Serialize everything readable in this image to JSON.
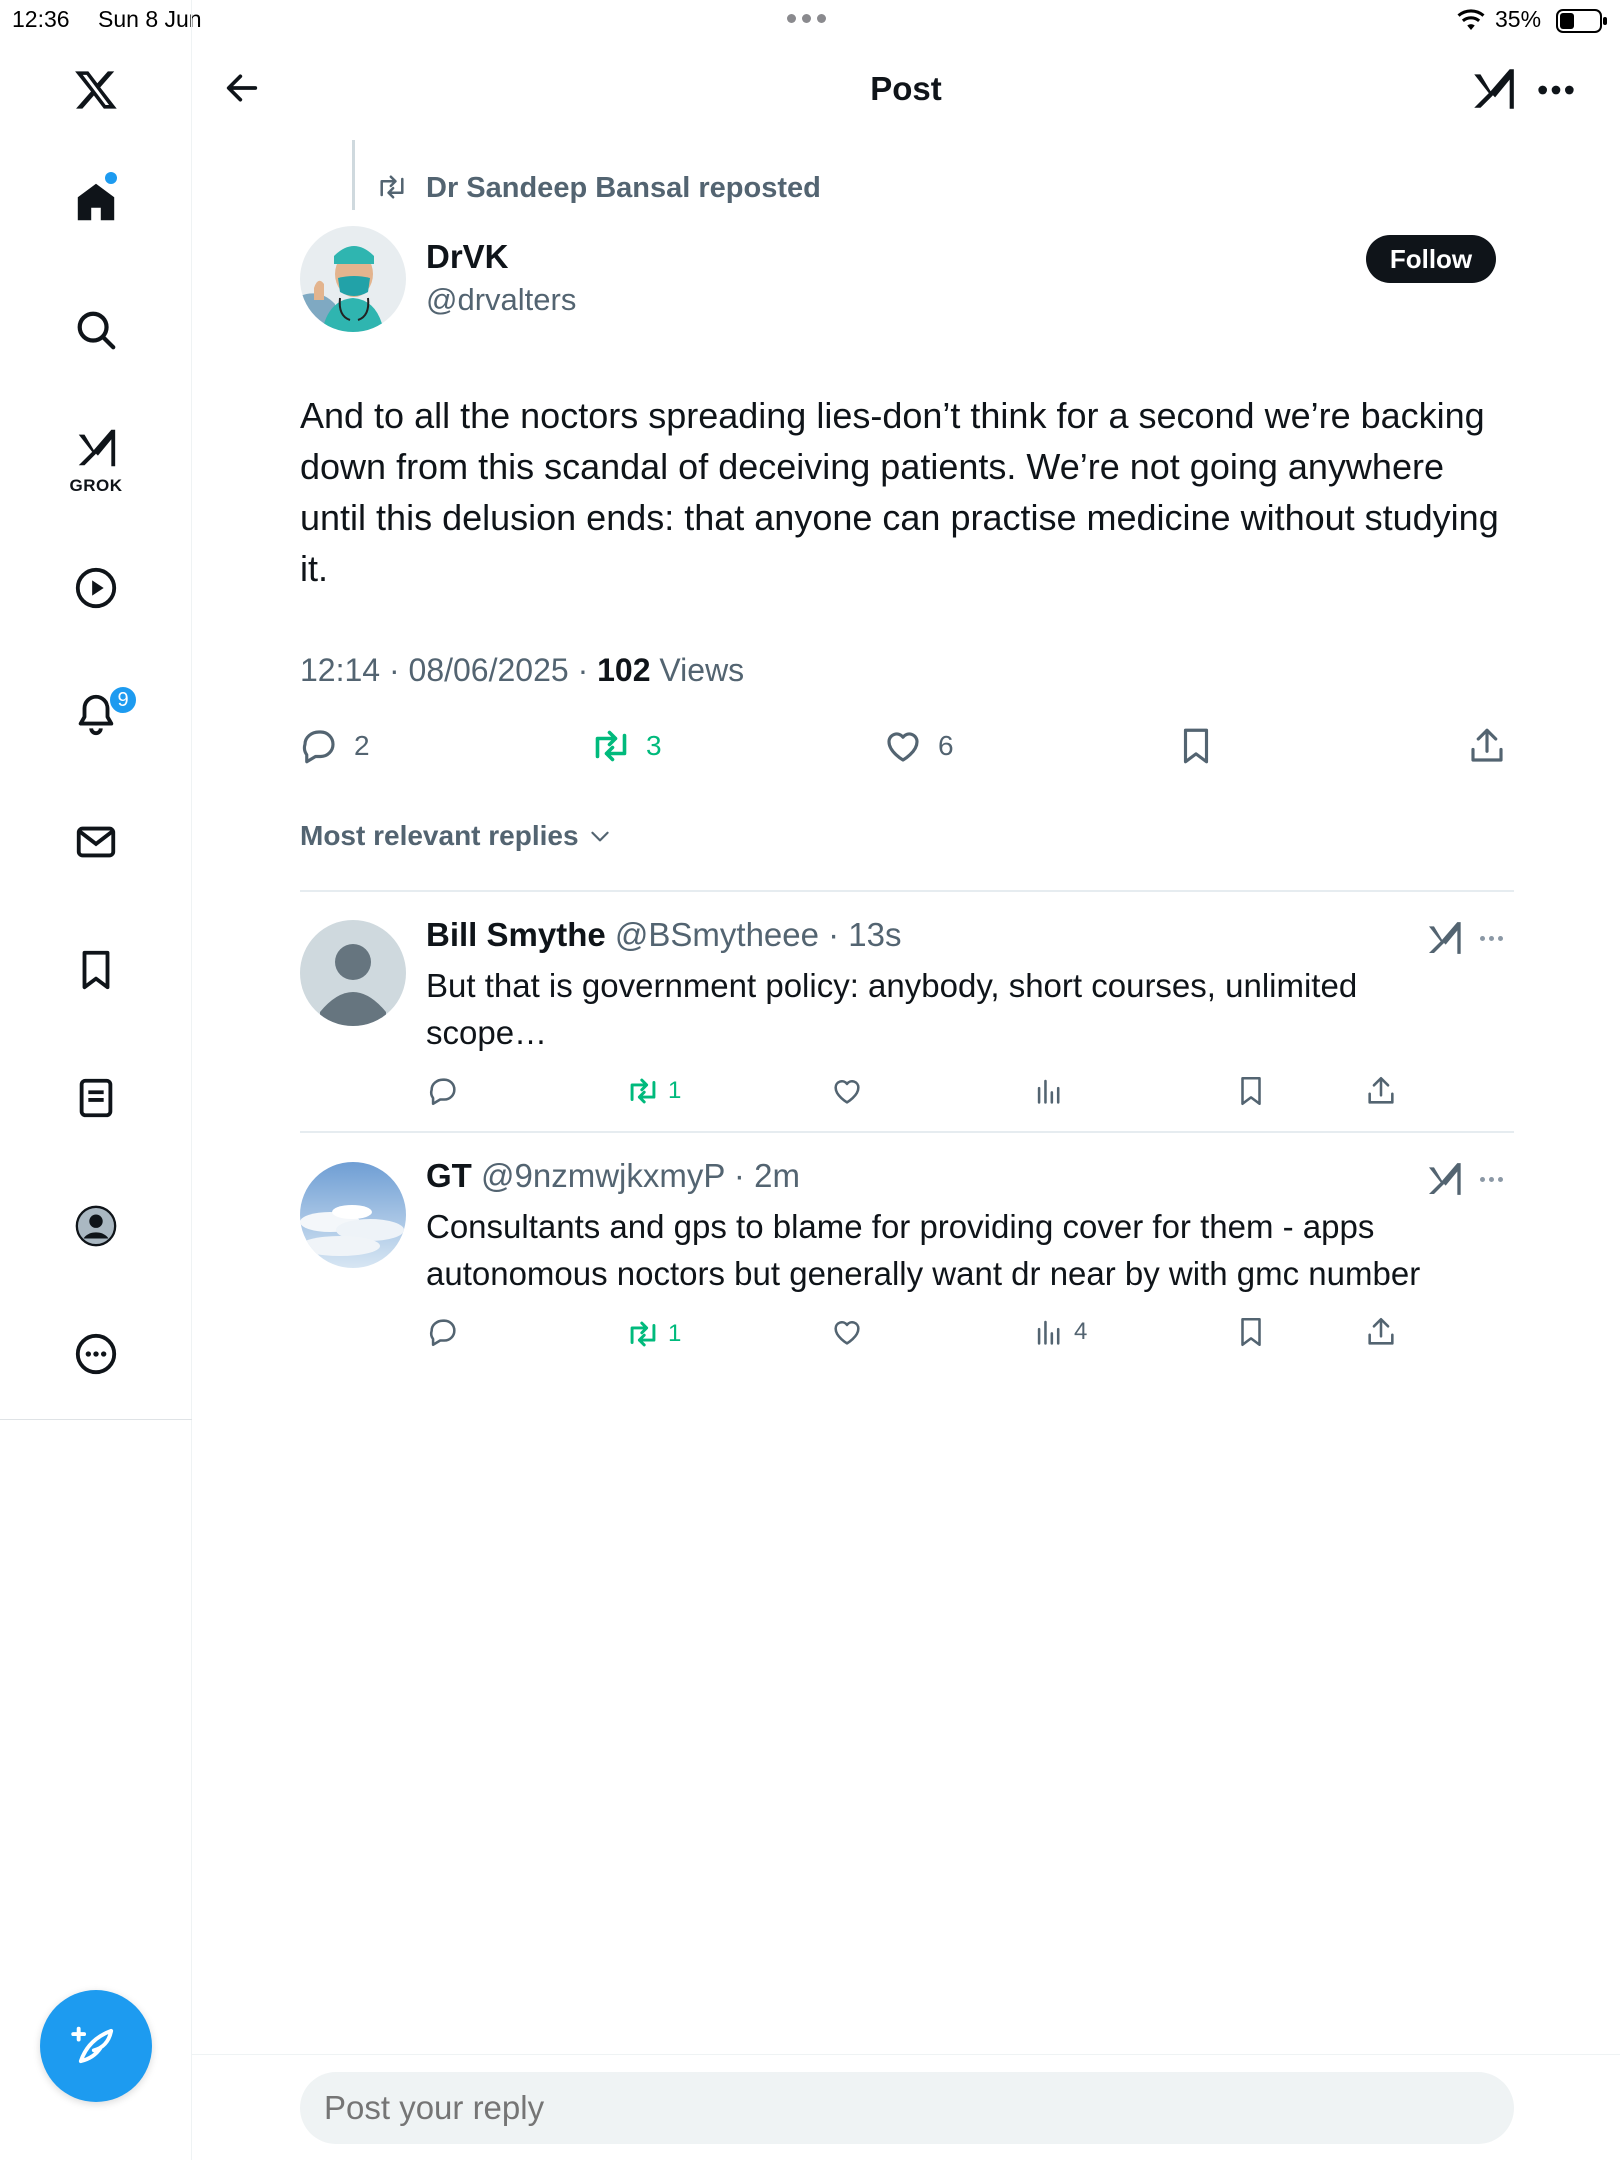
{
  "status_bar": {
    "time": "12:36",
    "date": "Sun 8 Jun",
    "battery": "35%"
  },
  "sidebar": {
    "grok_label": "GROK",
    "notifications_badge": "9"
  },
  "header": {
    "title": "Post"
  },
  "post": {
    "repost_text": "Dr Sandeep Bansal reposted",
    "author_name": "DrVK",
    "author_handle": "@drvalters",
    "follow_label": "Follow",
    "text": "And to all the noctors spreading lies-don’t think for a second we’re backing down from this scandal of deceiving patients. We’re not going anywhere until this delusion ends: that anyone can practise medicine without studying it.",
    "time": "12:14 · 08/06/2025 · ",
    "views_count": "102",
    "views_label": " Views",
    "stats": {
      "replies": "2",
      "reposts": "3",
      "likes": "6"
    }
  },
  "replies_sort_label": "Most relevant replies",
  "replies": [
    {
      "name": "Bill Smythe",
      "handle": "@BSmytheee",
      "time": " · 13s",
      "text": "But that is government policy: anybody, short courses, unlimited scope…",
      "reposts": "1",
      "views": ""
    },
    {
      "name": "GT",
      "handle": "@9nzmwjkxmyP",
      "time": " · 2m",
      "text": "Consultants and gps to blame for providing cover for them - apps autonomous noctors but generally want dr near by with gmc number",
      "reposts": "1",
      "views": "4"
    }
  ],
  "composer": {
    "placeholder": "Post your reply"
  },
  "colors": {
    "accent": "#1d9bf0",
    "repost_green": "#00ba7c",
    "muted": "#536471"
  }
}
